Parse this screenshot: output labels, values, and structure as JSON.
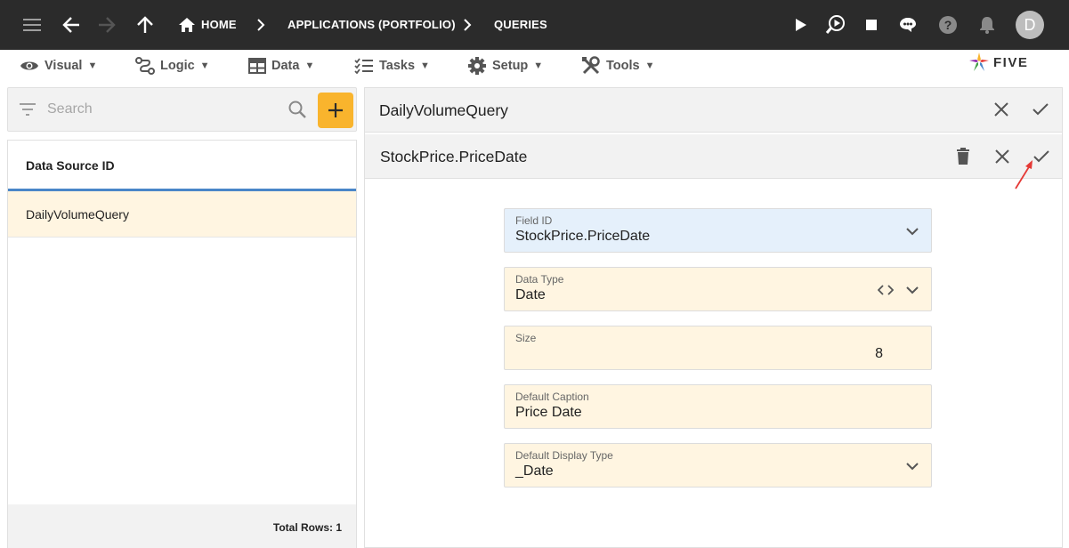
{
  "topbar": {
    "breadcrumbs": [
      "HOME",
      "APPLICATIONS (PORTFOLIO)",
      "QUERIES"
    ],
    "avatar_initial": "D"
  },
  "menu": {
    "items": [
      {
        "label": "Visual",
        "icon": "eye-icon"
      },
      {
        "label": "Logic",
        "icon": "logic-icon"
      },
      {
        "label": "Data",
        "icon": "table-icon"
      },
      {
        "label": "Tasks",
        "icon": "tasks-icon"
      },
      {
        "label": "Setup",
        "icon": "gear-icon"
      },
      {
        "label": "Tools",
        "icon": "tools-icon"
      }
    ],
    "caret": "▼",
    "logo_text": "FIVE"
  },
  "search": {
    "placeholder": "Search"
  },
  "list": {
    "column_header": "Data Source ID",
    "rows": [
      "DailyVolumeQuery"
    ],
    "footer": "Total Rows: 1"
  },
  "record": {
    "title": "DailyVolumeQuery"
  },
  "subrecord": {
    "title": "StockPrice.PriceDate"
  },
  "form": {
    "field_id": {
      "label": "Field ID",
      "value": "StockPrice.PriceDate"
    },
    "data_type": {
      "label": "Data Type",
      "value": "Date"
    },
    "size": {
      "label": "Size",
      "value": "8"
    },
    "default_caption": {
      "label": "Default Caption",
      "value": "Price Date"
    },
    "default_display_type": {
      "label": "Default Display Type",
      "value": "_Date"
    }
  },
  "colors": {
    "accent": "#f9b42d",
    "selected_row": "#fff5e1",
    "header_underline": "#4a86c8",
    "topbar": "#2b2b2b",
    "annotation_arrow": "#e53935"
  }
}
